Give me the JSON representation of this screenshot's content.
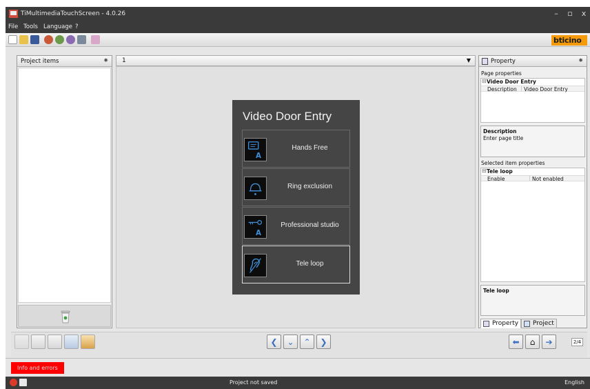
{
  "window": {
    "title": "TiMultimediaTouchScreen - 4.0.26",
    "min": "–",
    "max": "▫",
    "close": "x"
  },
  "menu": [
    "File",
    "Tools",
    "Language",
    "?"
  ],
  "brand": "bticino",
  "left_panel": {
    "title": "Project items",
    "pin": "✸"
  },
  "page_selector": {
    "value": "1",
    "dropdown": "▼"
  },
  "phone": {
    "title": "Video Door Entry",
    "buttons": [
      {
        "label": "Hands Free",
        "icon": "hands-free-icon"
      },
      {
        "label": "Ring exclusion",
        "icon": "ring-exclusion-icon"
      },
      {
        "label": "Professional studio",
        "icon": "professional-studio-icon"
      },
      {
        "label": "Tele loop",
        "icon": "tele-loop-icon"
      }
    ],
    "selected_index": 3
  },
  "right_panel": {
    "title": "Property",
    "pin": "✸",
    "page_properties_label": "Page properties",
    "page_group": {
      "name": "Video Door Entry",
      "key": "Description",
      "value": "Video Door Entry"
    },
    "description": {
      "heading": "Description",
      "text": "Enter page title"
    },
    "selected_label": "Selected item properties",
    "item_group": {
      "name": "Tele loop",
      "key": "Enable",
      "value": "Not enabled"
    },
    "item_desc": {
      "heading": "Tele loop"
    },
    "tabs": [
      "Property",
      "Project"
    ]
  },
  "nav": {
    "prev": "❮",
    "down": "⌄",
    "up": "⌃",
    "next": "❯",
    "back": "⬅",
    "home": "⌂",
    "forward": "➔"
  },
  "page_counter": "2/4",
  "info_button": "Info and errors",
  "status": {
    "message": "Project not saved",
    "language": "English"
  },
  "colors": {
    "chrome": "#3a3a3a",
    "accent_blue": "#3b6fc2",
    "phone_bg": "#454545",
    "brand_orange": "#f59a0b",
    "info_red": "#ff0000"
  }
}
